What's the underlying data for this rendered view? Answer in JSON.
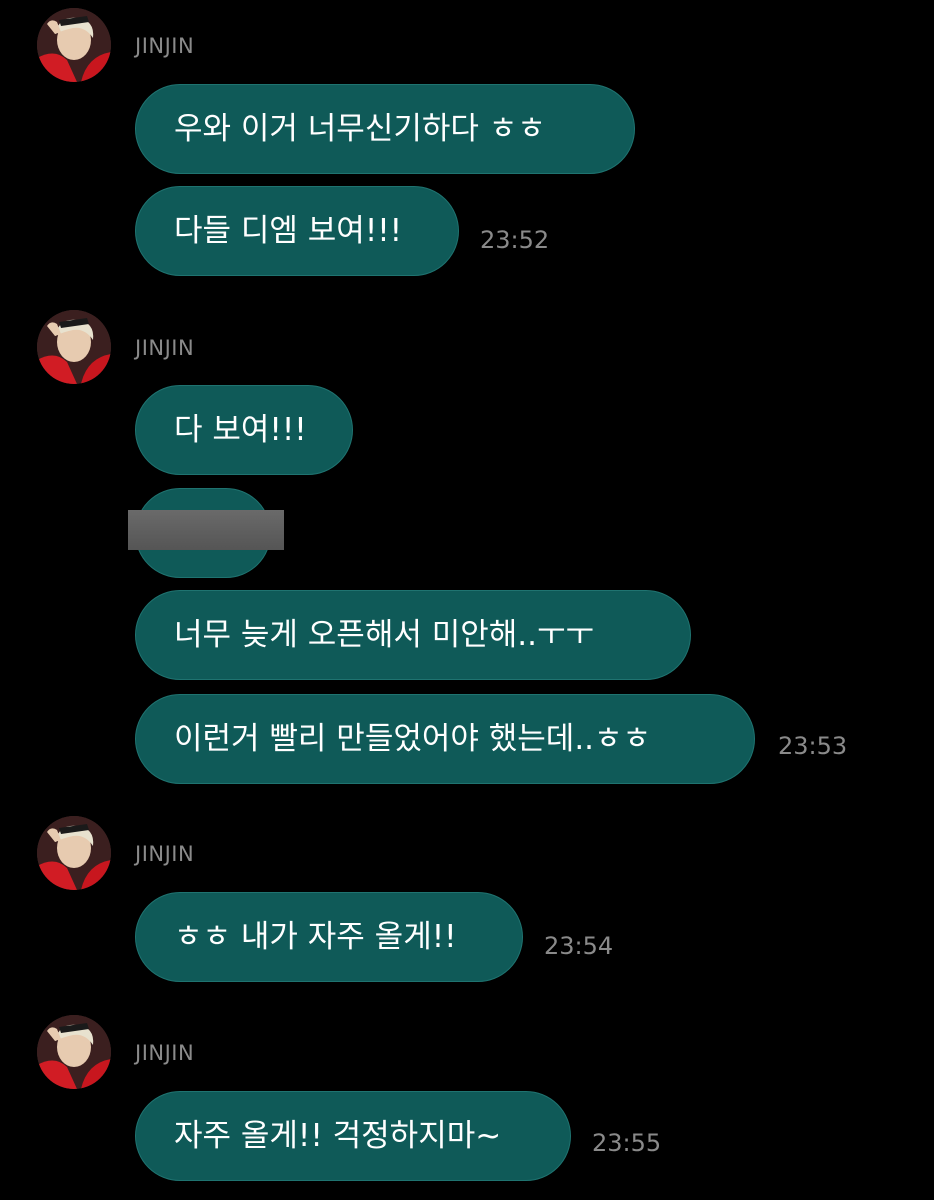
{
  "chat": {
    "groups": [
      {
        "sender": "JINJIN",
        "messages": [
          "우와 이거 너무신기하다 ㅎㅎ",
          "다들 디엠 보여!!!"
        ],
        "time": "23:52"
      },
      {
        "sender": "JINJIN",
        "messages": [
          "다 보여!!!",
          "",
          "너무 늦게 오픈해서 미안해..ㅜㅜ",
          "이런거 빨리 만들었어야 했는데..ㅎㅎ"
        ],
        "time": "23:53"
      },
      {
        "sender": "JINJIN",
        "messages": [
          "ㅎㅎ 내가 자주 올게!!"
        ],
        "time": "23:54"
      },
      {
        "sender": "JINJIN",
        "messages": [
          "자주 올게!! 걱정하지마~"
        ],
        "time": "23:55"
      }
    ]
  },
  "colors": {
    "background": "#000000",
    "bubble": "#0f5a58",
    "bubble_border": "#1f7370",
    "timestamp": "#8a8a8a"
  },
  "icons": {
    "avatar": "profile-photo",
    "redaction": "redaction-bar"
  }
}
